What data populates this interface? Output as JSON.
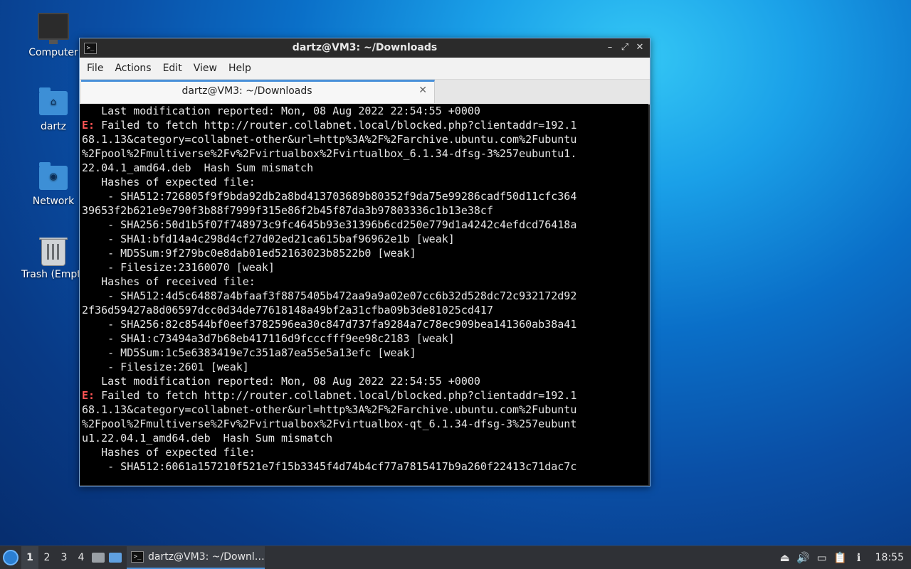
{
  "desktop": {
    "icons": [
      {
        "label": "Computer"
      },
      {
        "label": "dartz"
      },
      {
        "label": "Network"
      },
      {
        "label": "Trash (Empty)"
      }
    ]
  },
  "window": {
    "title": "dartz@VM3: ~/Downloads",
    "menu": [
      "File",
      "Actions",
      "Edit",
      "View",
      "Help"
    ],
    "tab_label": "dartz@VM3: ~/Downloads",
    "controls": {
      "minimize": "–",
      "maximize": "⤢",
      "close": "✕"
    }
  },
  "terminal": {
    "error_prefix": "E:",
    "lines": [
      {
        "text": "   Last modification reported: Mon, 08 Aug 2022 22:54:55 +0000"
      },
      {
        "err": true,
        "text": " Failed to fetch http://router.collabnet.local/blocked.php?clientaddr=192.1"
      },
      {
        "text": "68.1.13&category=collabnet-other&url=http%3A%2F%2Farchive.ubuntu.com%2Fubuntu"
      },
      {
        "text": "%2Fpool%2Fmultiverse%2Fv%2Fvirtualbox%2Fvirtualbox_6.1.34-dfsg-3%257eubuntu1."
      },
      {
        "text": "22.04.1_amd64.deb  Hash Sum mismatch"
      },
      {
        "text": "   Hashes of expected file:"
      },
      {
        "text": "    - SHA512:726805f9f9bda92db2a8bd413703689b80352f9da75e99286cadf50d11cfc364"
      },
      {
        "text": "39653f2b621e9e790f3b88f7999f315e86f2b45f87da3b97803336c1b13e38cf"
      },
      {
        "text": "    - SHA256:50d1b5f07f748973c9fc4645b93e31396b6cd250e779d1a4242c4efdcd76418a"
      },
      {
        "text": "    - SHA1:bfd14a4c298d4cf27d02ed21ca615baf96962e1b [weak]"
      },
      {
        "text": "    - MD5Sum:9f279bc0e8dab01ed52163023b8522b0 [weak]"
      },
      {
        "text": "    - Filesize:23160070 [weak]"
      },
      {
        "text": "   Hashes of received file:"
      },
      {
        "text": "    - SHA512:4d5c64887a4bfaaf3f8875405b472aa9a9a02e07cc6b32d528dc72c932172d92"
      },
      {
        "text": "2f36d59427a8d06597dcc0d34de77618148a49bf2a31cfba09b3de81025cd417"
      },
      {
        "text": "    - SHA256:82c8544bf0eef3782596ea30c847d737fa9284a7c78ec909bea141360ab38a41"
      },
      {
        "text": "    - SHA1:c73494a3d7b68eb417116d9fcccfff9ee98c2183 [weak]"
      },
      {
        "text": "    - MD5Sum:1c5e6383419e7c351a87ea55e5a13efc [weak]"
      },
      {
        "text": "    - Filesize:2601 [weak]"
      },
      {
        "text": "   Last modification reported: Mon, 08 Aug 2022 22:54:55 +0000"
      },
      {
        "err": true,
        "text": " Failed to fetch http://router.collabnet.local/blocked.php?clientaddr=192.1"
      },
      {
        "text": "68.1.13&category=collabnet-other&url=http%3A%2F%2Farchive.ubuntu.com%2Fubuntu"
      },
      {
        "text": "%2Fpool%2Fmultiverse%2Fv%2Fvirtualbox%2Fvirtualbox-qt_6.1.34-dfsg-3%257eubunt"
      },
      {
        "text": "u1.22.04.1_amd64.deb  Hash Sum mismatch"
      },
      {
        "text": "   Hashes of expected file:"
      },
      {
        "text": "    - SHA512:6061a157210f521e7f15b3345f4d74b4cf77a7815417b9a260f22413c71dac7c"
      }
    ]
  },
  "taskbar": {
    "workspaces": [
      "1",
      "2",
      "3",
      "4"
    ],
    "active_workspace": "1",
    "task_label": "dartz@VM3: ~/Downl…",
    "clock": "18:55"
  }
}
